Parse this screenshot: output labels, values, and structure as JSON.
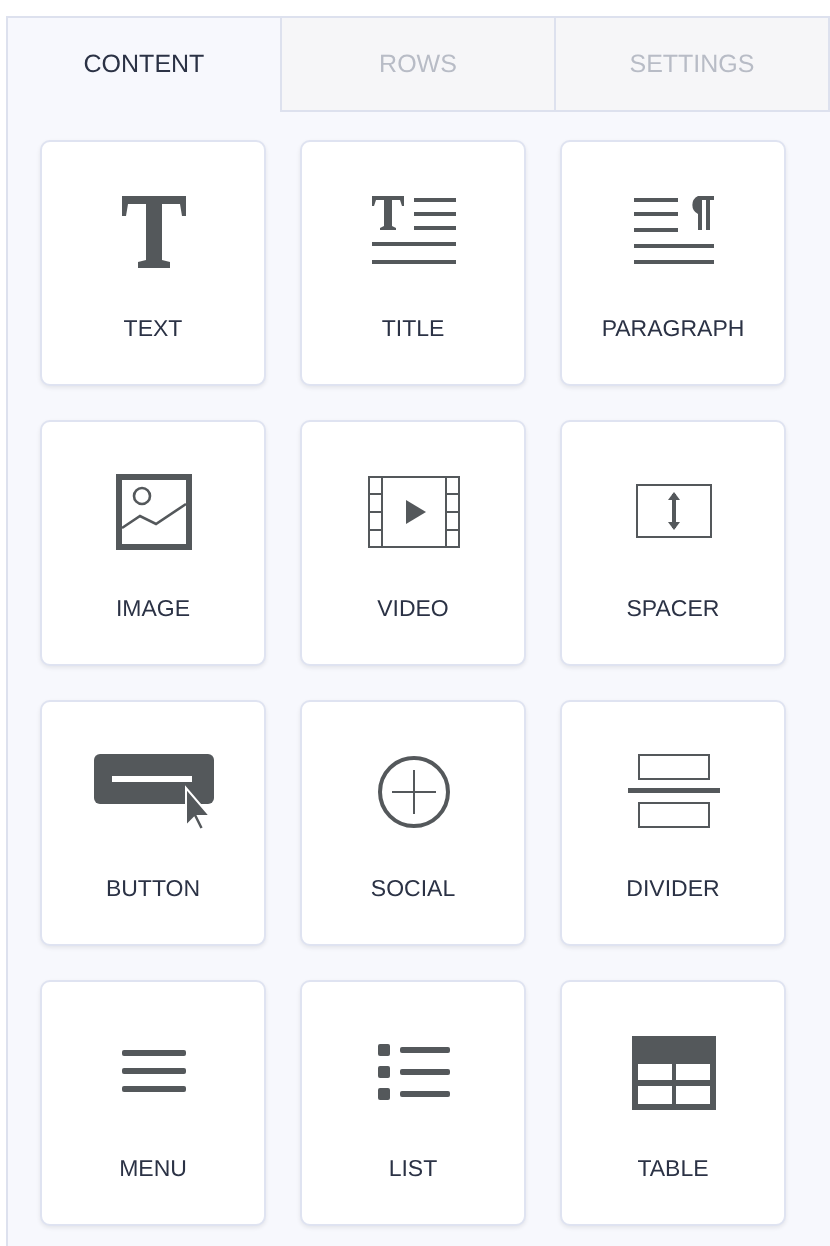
{
  "tabs": [
    {
      "label": "CONTENT",
      "selected": true
    },
    {
      "label": "ROWS",
      "selected": false
    },
    {
      "label": "SETTINGS",
      "selected": false
    }
  ],
  "blocks": [
    {
      "kind": "text",
      "label": "TEXT"
    },
    {
      "kind": "title",
      "label": "TITLE"
    },
    {
      "kind": "paragraph",
      "label": "PARAGRAPH"
    },
    {
      "kind": "image",
      "label": "IMAGE"
    },
    {
      "kind": "video",
      "label": "VIDEO"
    },
    {
      "kind": "spacer",
      "label": "SPACER"
    },
    {
      "kind": "button",
      "label": "BUTTON"
    },
    {
      "kind": "social",
      "label": "SOCIAL"
    },
    {
      "kind": "divider",
      "label": "DIVIDER"
    },
    {
      "kind": "menu",
      "label": "MENU"
    },
    {
      "kind": "list",
      "label": "LIST"
    },
    {
      "kind": "table",
      "label": "TABLE"
    }
  ]
}
